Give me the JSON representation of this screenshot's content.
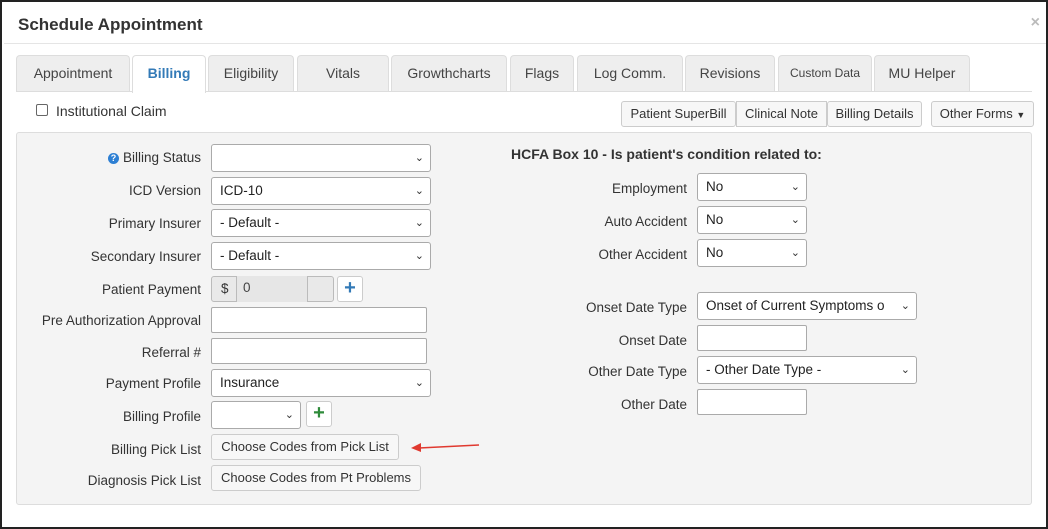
{
  "dialog": {
    "title": "Schedule Appointment",
    "close": "×"
  },
  "tabs": [
    {
      "label": "Appointment"
    },
    {
      "label": "Billing"
    },
    {
      "label": "Eligibility"
    },
    {
      "label": "Vitals"
    },
    {
      "label": "Growthcharts"
    },
    {
      "label": "Flags"
    },
    {
      "label": "Log Comm."
    },
    {
      "label": "Revisions"
    },
    {
      "label": "Custom Data"
    },
    {
      "label": "MU Helper"
    }
  ],
  "institutional_claim": {
    "label": "Institutional Claim",
    "checked": false
  },
  "toolbar": {
    "patient_superbill": "Patient SuperBill",
    "clinical_note": "Clinical Note",
    "billing_details": "Billing Details",
    "other_forms": "Other Forms"
  },
  "left": {
    "billing_status": {
      "label": "Billing Status",
      "value": ""
    },
    "icd_version": {
      "label": "ICD Version",
      "value": "ICD-10"
    },
    "primary_insurer": {
      "label": "Primary Insurer",
      "value": "- Default -"
    },
    "secondary_insurer": {
      "label": "Secondary Insurer",
      "value": "- Default -"
    },
    "patient_payment": {
      "label": "Patient Payment",
      "currency": "$",
      "value": "0"
    },
    "pre_auth": {
      "label": "Pre Authorization Approval",
      "value": ""
    },
    "referral": {
      "label": "Referral #",
      "value": ""
    },
    "payment_profile": {
      "label": "Payment Profile",
      "value": "Insurance"
    },
    "billing_profile": {
      "label": "Billing Profile",
      "value": ""
    },
    "billing_pick_list": {
      "label": "Billing Pick List",
      "button": "Choose Codes from Pick List"
    },
    "diagnosis_pick_list": {
      "label": "Diagnosis Pick List",
      "button": "Choose Codes from Pt Problems"
    }
  },
  "right": {
    "heading": "HCFA Box 10 - Is patient's condition related to:",
    "employment": {
      "label": "Employment",
      "value": "No"
    },
    "auto_accident": {
      "label": "Auto Accident",
      "value": "No"
    },
    "other_accident": {
      "label": "Other Accident",
      "value": "No"
    },
    "onset_date_type": {
      "label": "Onset Date Type",
      "value": "Onset of Current Symptoms o"
    },
    "onset_date": {
      "label": "Onset Date",
      "value": ""
    },
    "other_date_type": {
      "label": "Other Date Type",
      "value": "- Other Date Type -"
    },
    "other_date": {
      "label": "Other Date",
      "value": ""
    }
  },
  "colors": {
    "accent": "#337ab7",
    "annotation_arrow": "#e0392f",
    "plus_green": "#2e8b3a"
  }
}
